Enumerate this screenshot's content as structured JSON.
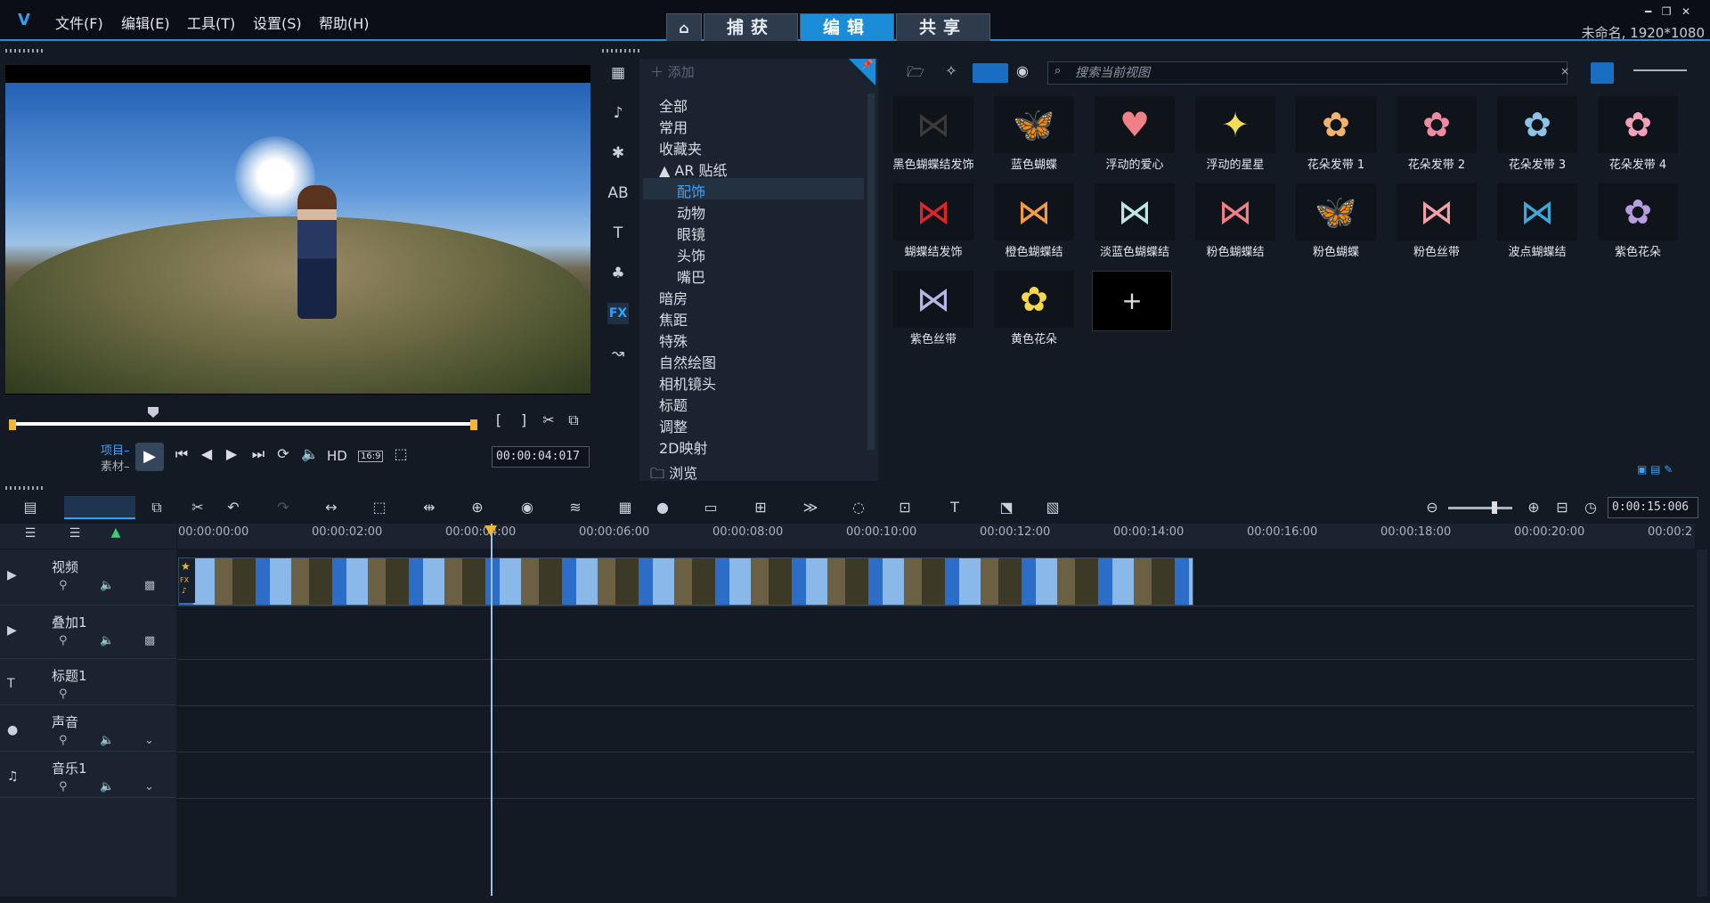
{
  "app": {
    "logo": "V",
    "project_name": "未命名, 1920*1080"
  },
  "menu": [
    "文件(F)",
    "编辑(E)",
    "工具(T)",
    "设置(S)",
    "帮助(H)"
  ],
  "mode_tabs": {
    "home_icon": "home-icon",
    "capture": "捕获",
    "edit": "编辑",
    "share": "共享"
  },
  "player": {
    "mode_project": "项目",
    "mode_clip": "素材",
    "hd": "HD",
    "ratio": "16:9",
    "timecode": "00:00:04:017"
  },
  "library": {
    "add_label": "添加",
    "search_placeholder": "搜索当前视图",
    "tree": [
      {
        "label": "全部",
        "level": 0
      },
      {
        "label": "常用",
        "level": 0
      },
      {
        "label": "收藏夹",
        "level": 0
      },
      {
        "label": "▲ AR 贴纸",
        "level": 0
      },
      {
        "label": "配饰",
        "level": 1,
        "selected": true
      },
      {
        "label": "动物",
        "level": 1
      },
      {
        "label": "眼镜",
        "level": 1
      },
      {
        "label": "头饰",
        "level": 1
      },
      {
        "label": "嘴巴",
        "level": 1
      },
      {
        "label": "暗房",
        "level": 0
      },
      {
        "label": "焦距",
        "level": 0
      },
      {
        "label": "特殊",
        "level": 0
      },
      {
        "label": "自然绘图",
        "level": 0
      },
      {
        "label": "相机镜头",
        "level": 0
      },
      {
        "label": "标题",
        "level": 0
      },
      {
        "label": "调整",
        "level": 0
      },
      {
        "label": "2D映射",
        "level": 0
      }
    ],
    "browse": "浏览",
    "items": [
      {
        "label": "黑色蝴蝶结发饰",
        "color": "#3a3a3a",
        "glyph": "⋈"
      },
      {
        "label": "蓝色蝴蝶",
        "color": "#8cc4e8",
        "glyph": "🦋"
      },
      {
        "label": "浮动的爱心",
        "color": "#f07f86",
        "glyph": "♥"
      },
      {
        "label": "浮动的星星",
        "color": "#f3dd55",
        "glyph": "✦"
      },
      {
        "label": "花朵发带 1",
        "color": "#f2b36a",
        "glyph": "✿"
      },
      {
        "label": "花朵发带 2",
        "color": "#f08aa0",
        "glyph": "✿"
      },
      {
        "label": "花朵发带 3",
        "color": "#8cc4e8",
        "glyph": "✿"
      },
      {
        "label": "花朵发带 4",
        "color": "#f3a0b8",
        "glyph": "✿"
      },
      {
        "label": "蝴蝶结发饰",
        "color": "#e0252a",
        "glyph": "⋈"
      },
      {
        "label": "橙色蝴蝶结",
        "color": "#f39b44",
        "glyph": "⋈"
      },
      {
        "label": "淡蓝色蝴蝶结",
        "color": "#bfe6df",
        "glyph": "⋈"
      },
      {
        "label": "粉色蝴蝶结",
        "color": "#f07f86",
        "glyph": "⋈"
      },
      {
        "label": "粉色蝴蝶",
        "color": "#f07f86",
        "glyph": "🦋"
      },
      {
        "label": "粉色丝带",
        "color": "#f2a0a8",
        "glyph": "⋈"
      },
      {
        "label": "波点蝴蝶结",
        "color": "#3fa8d8",
        "glyph": "⋈"
      },
      {
        "label": "紫色花朵",
        "color": "#b79ce0",
        "glyph": "✿"
      },
      {
        "label": "紫色丝带",
        "color": "#b8b4e4",
        "glyph": "⋈"
      },
      {
        "label": "黄色花朵",
        "color": "#f6d94a",
        "glyph": "✿"
      }
    ],
    "add_tile": "+"
  },
  "timeline": {
    "duration": "0:00:15:006",
    "ruler": [
      "00:00:00:00",
      "00:00:02:00",
      "00:00:04:00",
      "00:00:06:00",
      "00:00:08:00",
      "00:00:10:00",
      "00:00:12:00",
      "00:00:14:00",
      "00:00:16:00",
      "00:00:18:00",
      "00:00:20:00",
      "00:00:2"
    ],
    "tracks": [
      {
        "name": "视频"
      },
      {
        "name": "叠加1"
      },
      {
        "name": "标题1"
      },
      {
        "name": "声音"
      },
      {
        "name": "音乐1"
      }
    ],
    "clip_fx": "FX"
  },
  "colors": {
    "accent": "#1a8cd8",
    "panel": "#1b2330",
    "background": "#141a24"
  }
}
